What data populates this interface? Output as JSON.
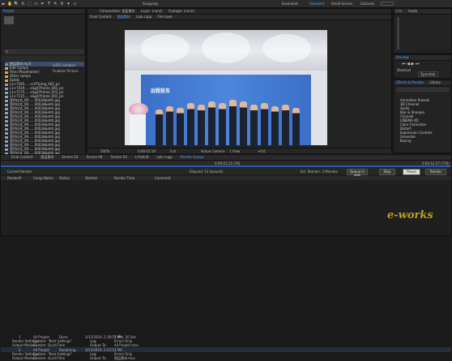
{
  "toolbar": {
    "tools": [
      "►",
      "✋",
      "🔍",
      "↻",
      "⬚",
      "▭",
      "✒",
      "T",
      "✎",
      "⚲",
      "✦",
      "⊹"
    ],
    "snapping_label": "Snapping",
    "workspaces": [
      "Essentials",
      "Standard",
      "Small Screen",
      "Libraries"
    ],
    "active_workspace": "Standard"
  },
  "project": {
    "tab_label": "Project",
    "selected_name": "图层素材 ...ffff-0.0ms.0.png",
    "selected_info": "1280 x 720",
    "search_placeholder": "",
    "rows": [
      {
        "name": "图层素材.mp4",
        "type": "vid"
      },
      {
        "name": "Edit Comps",
        "type": "folder"
      },
      {
        "name": "Files (Placeholder)",
        "type": "folder"
      },
      {
        "name": "Other comps",
        "type": "folder"
      },
      {
        "name": "Solids",
        "type": "folder"
      },
      {
        "name": "L1+7495.....+nf7&img_002_pn",
        "type": "file"
      },
      {
        "name": "L1+7419.....+&gt7frame_042_pn",
        "type": "file"
      },
      {
        "name": "L1+7175.....+&gt7frame_051_pn",
        "type": "file"
      },
      {
        "name": "L1+7115.....+&gt7frame_001_pn",
        "type": "file"
      },
      {
        "name": "签约仪式_09......0003d&ehtr.jpg",
        "type": "file"
      },
      {
        "name": "签约仪式_09......0003d&ehtr.jpg",
        "type": "file"
      },
      {
        "name": "签约仪式_09......0003d&ehtr.jpg",
        "type": "file"
      },
      {
        "name": "签约仪式_09......0003d&ehtr.jpg",
        "type": "file"
      },
      {
        "name": "签约仪式_09......0003d&ehtr.jpg",
        "type": "file"
      },
      {
        "name": "签约仪式_09......0003d&ehtr.jpg",
        "type": "file"
      },
      {
        "name": "签约仪式_09......0003d&ehtr.jpg",
        "type": "file"
      },
      {
        "name": "签约仪式_09......0003d&ehtr.jpg",
        "type": "file"
      },
      {
        "name": "签约仪式_09......0003d&ehtr.jpg",
        "type": "file"
      },
      {
        "name": "签约仪式_09......0003d&ehtr.jpg",
        "type": "file"
      },
      {
        "name": "签约仪式_09......0003d&ehtr.jpg",
        "type": "file"
      },
      {
        "name": "签约仪式_09......0003d&ehtr.jpg",
        "type": "file"
      },
      {
        "name": "签约仪式_09......0003d&ehtr.jpg",
        "type": "file"
      },
      {
        "name": "签约仪式_09......0003d&ehtr.jpg",
        "type": "file"
      }
    ],
    "bpc_label": "8 bpc"
  },
  "project_mid": {
    "col1": "LUSS samples",
    "col2": "Finalizer Picture"
  },
  "composition": {
    "header_tabs": [
      "Composition: 图层素材",
      "Layer: (none)",
      "Footage: (none)"
    ],
    "tabs": [
      "Final Content",
      "图层素材",
      "Lala cupp",
      "Fire layer"
    ],
    "banner_text": "远程投车",
    "footer": {
      "zoom": "100%",
      "timecode": "0:00:01:19",
      "quality": "Full",
      "camera": "Active Camera",
      "view": "1 View",
      "offset": "+0.0"
    }
  },
  "timeline": {
    "tabs": [
      "Final Content",
      "图层素材",
      "Screen 02",
      "Screen 04",
      "Screen 03",
      "L:Fanlu9",
      "Lala cupp",
      "Render Queue"
    ],
    "active_tab": "Render Queue",
    "elapsed": "0:00:01:15 (76)",
    "total": "0:00:12:27 (776)",
    "status_left": "Current Render",
    "elapsed_label": "Elapsed: 13 Seconds",
    "remaining_label": "Est. Remain: 3 Minutes",
    "btn_queue": "Queue in AME",
    "btn_stop": "Stop",
    "btn_pause": "Pause",
    "btn_render": "Render",
    "columns": [
      "Render",
      "#",
      "Comp Name",
      "Status",
      "Started",
      "Render Time",
      "Comment"
    ],
    "rows": [
      {
        "n": "1",
        "comp": "All Project",
        "status": "Done",
        "started": "3/12/2019, 2:18:57 PM",
        "time": "5 Min, 16 Sec"
      },
      {
        "n": "2",
        "comp": "All Project",
        "status": "Rendering",
        "started": "3/12/2019, 2:23:13 PM",
        "time": "-"
      }
    ],
    "sub1_label": "Render Settings:",
    "sub1_value": "Custom: \"Best Settings\"",
    "sub1_log": "Log:",
    "sub1_log_value": "Errors Only",
    "sub2_label": "Output Module:",
    "sub2_value": "Custom: QuickTime",
    "sub2_out": "Output To:",
    "sub2_out_value": "All Project.mov",
    "sub3_label": "Render Settings:",
    "sub3_value": "Custom: \"Best Settings\"",
    "sub4_label": "Output Module:",
    "sub4_value": "Custom: QuickTime",
    "sub4_out_value": "图层素材.mov"
  },
  "right": {
    "tabs": [
      "Info",
      "Audio"
    ],
    "preview_label": "Preview",
    "shortcut_label": "Shortcut",
    "shortcut_value": "Spacebar",
    "effects_tab": "Effects & Presets",
    "effects_tab2": "Library",
    "effects": [
      "Animation Presets",
      "3D Channel",
      "Audio",
      "Blur & Sharpen",
      "Channel",
      "CINEMA 4D",
      "Color Correction",
      "Distort",
      "Expression Controls",
      "Generate",
      "Keying"
    ]
  },
  "watermark": "e-works"
}
